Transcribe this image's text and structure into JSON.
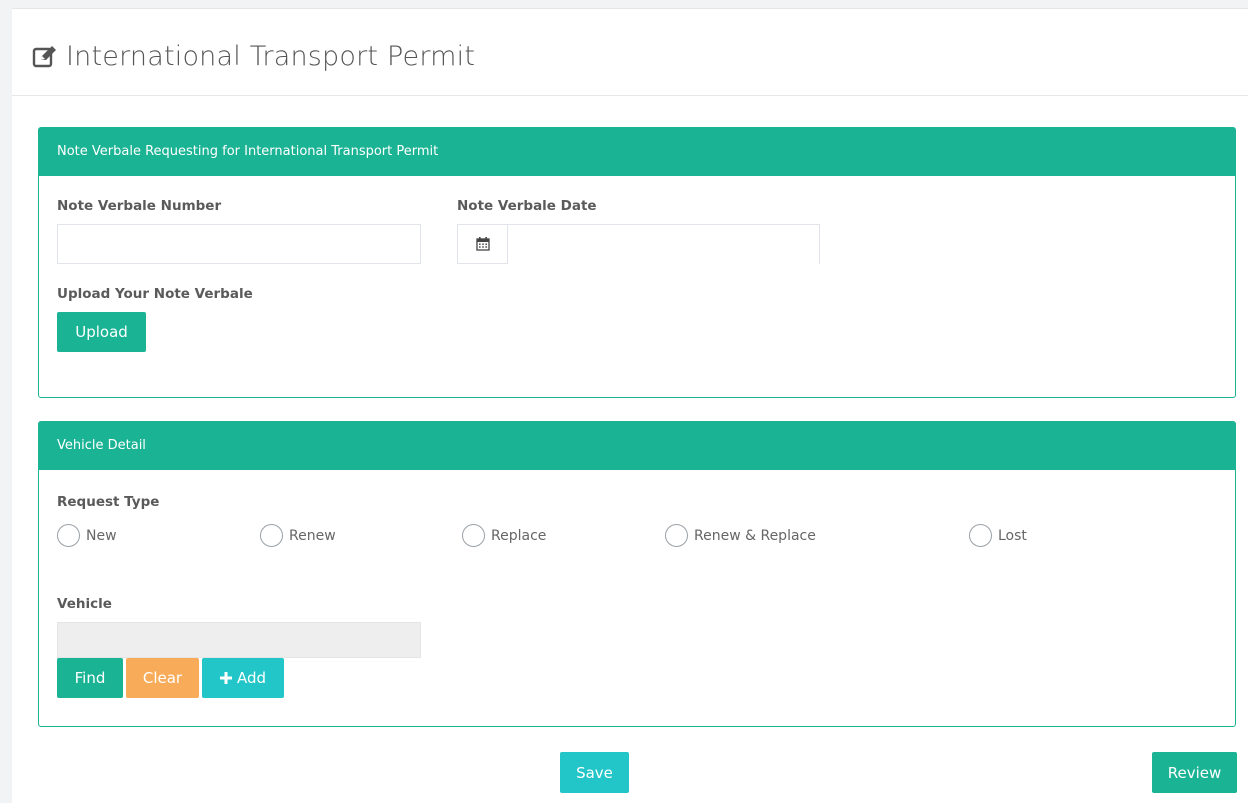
{
  "page": {
    "title": "International Transport Permit",
    "title_icon": "edit-icon"
  },
  "note_verbale_panel": {
    "heading": "Note Verbale Requesting for International Transport Permit",
    "number_label": "Note Verbale Number",
    "number_value": "",
    "date_label": "Note Verbale Date",
    "date_value": "",
    "upload_label": "Upload Your Note Verbale",
    "upload_button": "Upload"
  },
  "vehicle_panel": {
    "heading": "Vehicle Detail",
    "request_type_label": "Request Type",
    "request_types": [
      "New",
      "Renew",
      "Replace",
      "Renew & Replace",
      "Lost"
    ],
    "vehicle_label": "Vehicle",
    "vehicle_value": "",
    "find_button": "Find",
    "clear_button": "Clear",
    "add_button": "Add"
  },
  "actions": {
    "save_button": "Save",
    "review_button": "Review"
  },
  "colors": {
    "primary": "#1ab394",
    "warning": "#f8ac59",
    "info": "#23c6c8"
  }
}
